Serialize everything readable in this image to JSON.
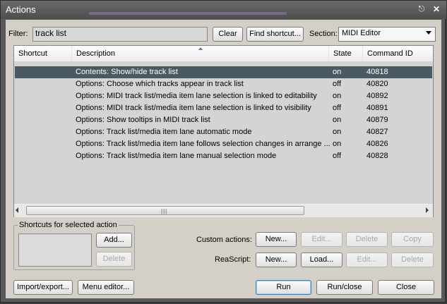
{
  "window": {
    "title": "Actions",
    "pin_icon": "pin-icon",
    "close_icon": "close-icon"
  },
  "filter": {
    "label": "Filter:",
    "value": "track list",
    "clear_label": "Clear",
    "find_shortcut_label": "Find shortcut..."
  },
  "section": {
    "label": "Section:",
    "value": "MIDI Editor"
  },
  "list": {
    "columns": [
      "Shortcut",
      "Description",
      "State",
      "Command ID"
    ],
    "rows": [
      {
        "shortcut": "",
        "description": "Contents: Show/hide track list",
        "state": "on",
        "command_id": "40818",
        "selected": true
      },
      {
        "shortcut": "",
        "description": "Options: Choose which tracks appear in track list",
        "state": "off",
        "command_id": "40820"
      },
      {
        "shortcut": "",
        "description": "Options: MIDI track list/media item lane selection is linked to editability",
        "state": "on",
        "command_id": "40892"
      },
      {
        "shortcut": "",
        "description": "Options: MIDI track list/media item lane selection is linked to visibility",
        "state": "off",
        "command_id": "40891"
      },
      {
        "shortcut": "",
        "description": "Options: Show tooltips in MIDI track list",
        "state": "on",
        "command_id": "40879"
      },
      {
        "shortcut": "",
        "description": "Options: Track list/media item lane automatic mode",
        "state": "on",
        "command_id": "40827"
      },
      {
        "shortcut": "",
        "description": "Options: Track list/media item lane follows selection changes in arrange ...",
        "state": "on",
        "command_id": "40826"
      },
      {
        "shortcut": "",
        "description": "Options: Track list/media item lane manual selection mode",
        "state": "off",
        "command_id": "40828"
      }
    ]
  },
  "shortcuts_group": {
    "title": "Shortcuts for selected action",
    "add_label": "Add...",
    "delete_label": "Delete"
  },
  "custom_actions": {
    "label": "Custom actions:",
    "new_label": "New...",
    "edit_label": "Edit...",
    "delete_label": "Delete",
    "copy_label": "Copy"
  },
  "reascript": {
    "label": "ReaScript:",
    "new_label": "New...",
    "load_label": "Load...",
    "edit_label": "Edit...",
    "delete_label": "Delete"
  },
  "footer": {
    "import_export_label": "Import/export...",
    "menu_editor_label": "Menu editor...",
    "run_label": "Run",
    "run_close_label": "Run/close",
    "close_label": "Close"
  }
}
